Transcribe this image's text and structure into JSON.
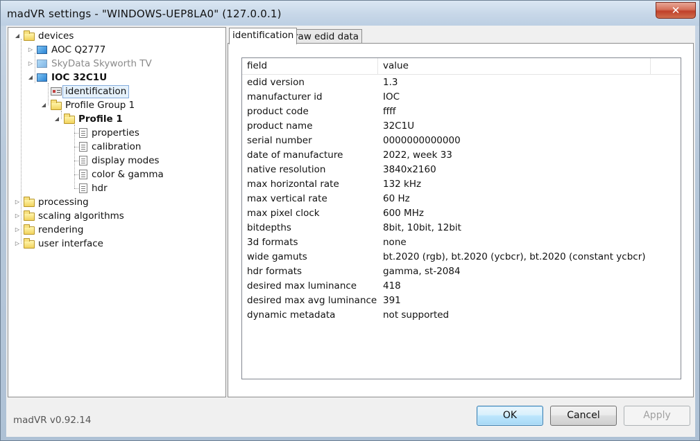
{
  "window": {
    "title": "madVR settings - \"WINDOWS-UEP8LA0\" (127.0.0.1)",
    "close_label": "✕"
  },
  "tree": {
    "devices": "devices",
    "aoc": "AOC Q2777",
    "skydata": "SkyData Skyworth TV",
    "ioc": "IOC 32C1U",
    "identification": "identification",
    "profile_group": "Profile Group 1",
    "profile": "Profile 1",
    "properties": "properties",
    "calibration": "calibration",
    "display_modes": "display modes",
    "color_gamma": "color & gamma",
    "hdr": "hdr",
    "processing": "processing",
    "scaling": "scaling algorithms",
    "rendering": "rendering",
    "user_interface": "user interface"
  },
  "version": "madVR v0.92.14",
  "tabs": {
    "identification": "identification",
    "raw_edid": "raw edid data"
  },
  "table": {
    "headers": {
      "field": "field",
      "value": "value"
    },
    "rows": [
      {
        "field": "edid version",
        "value": "1.3"
      },
      {
        "field": "manufacturer id",
        "value": "IOC"
      },
      {
        "field": "product code",
        "value": "ffff"
      },
      {
        "field": "product name",
        "value": "32C1U"
      },
      {
        "field": "serial number",
        "value": "0000000000000"
      },
      {
        "field": "date of manufacture",
        "value": "2022, week 33"
      },
      {
        "field": "native resolution",
        "value": "3840x2160"
      },
      {
        "field": "max horizontal rate",
        "value": "132 kHz"
      },
      {
        "field": "max vertical rate",
        "value": "60 Hz"
      },
      {
        "field": "max pixel clock",
        "value": "600 MHz"
      },
      {
        "field": "bitdepths",
        "value": "8bit, 10bit, 12bit"
      },
      {
        "field": "3d formats",
        "value": "none"
      },
      {
        "field": "wide gamuts",
        "value": "bt.2020 (rgb), bt.2020 (ycbcr), bt.2020 (constant ycbcr)"
      },
      {
        "field": "hdr formats",
        "value": "gamma, st-2084"
      },
      {
        "field": "desired max luminance",
        "value": "418"
      },
      {
        "field": "desired max avg luminance",
        "value": "391"
      },
      {
        "field": "dynamic metadata",
        "value": "not supported"
      }
    ]
  },
  "buttons": {
    "ok": "OK",
    "cancel": "Cancel",
    "apply": "Apply"
  }
}
